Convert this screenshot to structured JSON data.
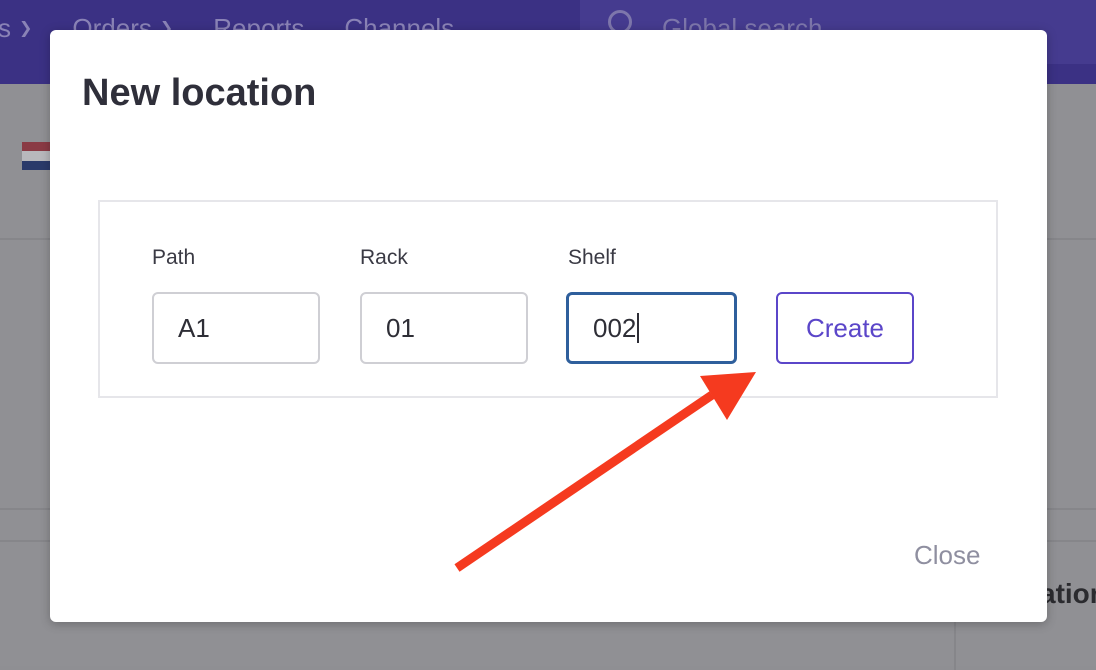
{
  "background": {
    "nav_items": [
      {
        "label": "s",
        "has_chevron": true
      },
      {
        "label": "Orders",
        "has_chevron": true
      },
      {
        "label": "Reports",
        "has_chevron": false
      },
      {
        "label": "Channels",
        "has_chevron": false
      }
    ],
    "search_placeholder": "Global search",
    "partial_heading": "ation",
    "colors": {
      "topbar": "#3b3184",
      "flag": [
        "#ae1c28",
        "#ffffff",
        "#21468b"
      ]
    }
  },
  "modal": {
    "title": "New location",
    "fields": [
      {
        "label": "Path",
        "value": "A1",
        "focused": false
      },
      {
        "label": "Rack",
        "value": "01",
        "focused": false
      },
      {
        "label": "Shelf",
        "value": "002",
        "focused": true
      }
    ],
    "create_label": "Create",
    "close_label": "Close",
    "accent_color": "#5b46c9",
    "annotation_arrow_color": "#f53a1f"
  }
}
